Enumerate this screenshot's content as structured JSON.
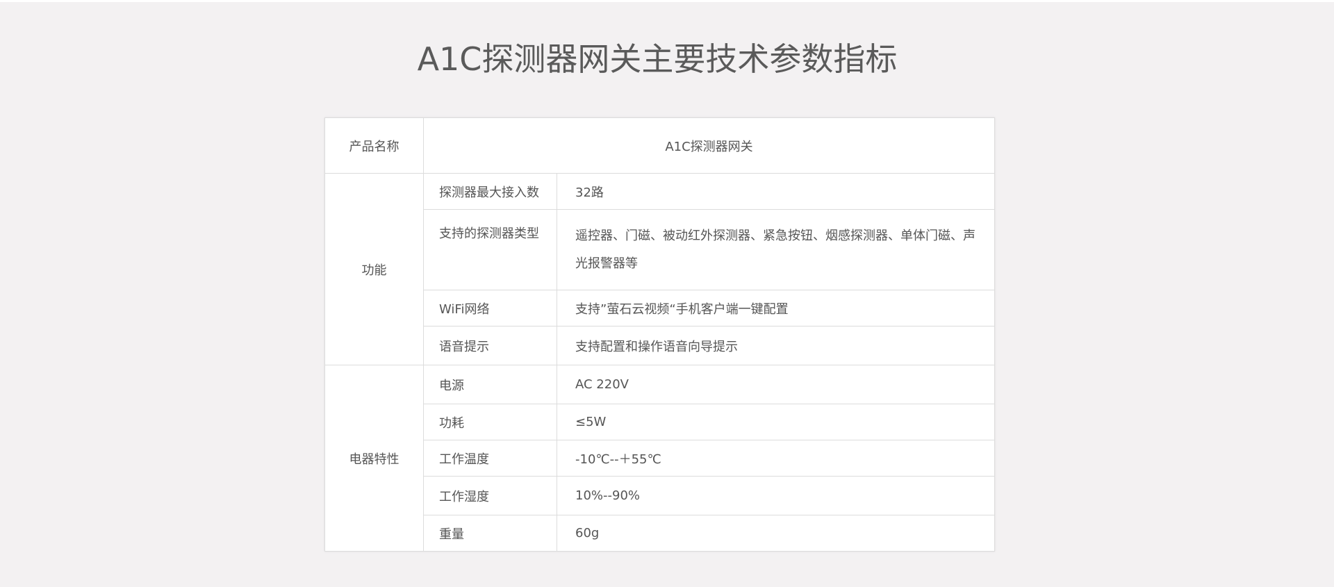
{
  "page": {
    "title": "A1C探测器网关主要技术参数指标"
  },
  "table": {
    "product_name_label": "产品名称",
    "product_name_value": "A1C探测器网关",
    "groups": [
      {
        "name": "功能",
        "rows": [
          {
            "label": "探测器最大接入数",
            "value": "32路"
          },
          {
            "label": "支持的探测器类型",
            "value": "遥控器、门磁、被动红外探测器、紧急按钮、烟感探测器、单体门磁、声光报警器等"
          },
          {
            "label": "WiFi网络",
            "value": "支持”萤石云视频“手机客户端一键配置"
          },
          {
            "label": "语音提示",
            "value": "支持配置和操作语音向导提示"
          }
        ]
      },
      {
        "name": "电器特性",
        "rows": [
          {
            "label": "电源",
            "value": "AC 220V"
          },
          {
            "label": "功耗",
            "value": "≤5W"
          },
          {
            "label": "工作温度",
            "value": "-10℃--＋55℃"
          },
          {
            "label": "工作湿度",
            "value": "10%--90%"
          },
          {
            "label": "重量",
            "value": "60g"
          }
        ]
      }
    ]
  }
}
